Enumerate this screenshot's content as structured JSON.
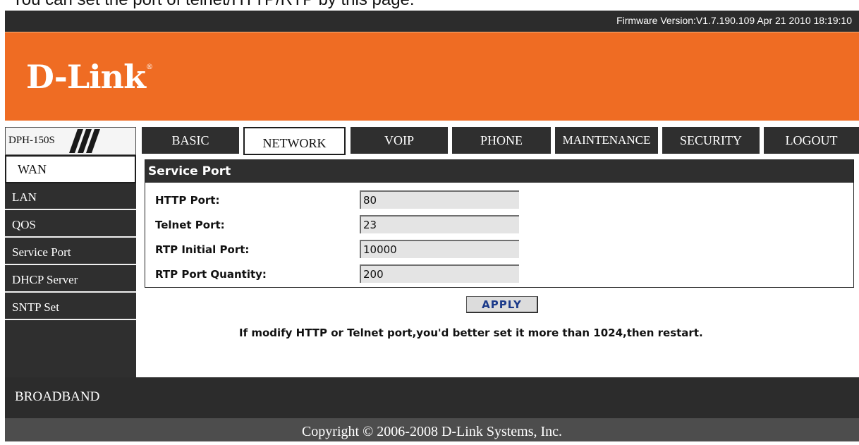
{
  "caption": "You can set the port of telnet/HTTP/RTP by this page.",
  "firmware": "Firmware Version:V1.7.190.109 Apr 21 2010 18:19:10",
  "brand": {
    "logo_text": "D-Link",
    "trademark": "®"
  },
  "colors": {
    "orange": "#ef6c23",
    "dark": "#2f2f2f",
    "apply_text": "#1b3a8a"
  },
  "model": "DPH-150S",
  "nav": {
    "basic": "BASIC",
    "network": "NETWORK",
    "voip": "VOIP",
    "phone": "PHONE",
    "maintenance": "MAINTENANCE",
    "security": "SECURITY",
    "logout": "LOGOUT",
    "active": "NETWORK"
  },
  "sidebar": {
    "items": [
      "WAN",
      "LAN",
      "QOS",
      "Service Port",
      "DHCP Server",
      "SNTP Set"
    ],
    "active": "WAN"
  },
  "panel": {
    "title": "Service Port",
    "fields": [
      {
        "label": "HTTP Port:",
        "value": "80"
      },
      {
        "label": "Telnet Port:",
        "value": "23"
      },
      {
        "label": "RTP Initial Port:",
        "value": "10000"
      },
      {
        "label": "RTP Port Quantity:",
        "value": "200"
      }
    ]
  },
  "apply_label": "APPLY",
  "note": "If modify HTTP or Telnet port,you'd better set it more than 1024,then restart.",
  "footer": {
    "broadband": "BROADBAND",
    "copyright": "Copyright © 2006-2008 D-Link Systems, Inc."
  }
}
